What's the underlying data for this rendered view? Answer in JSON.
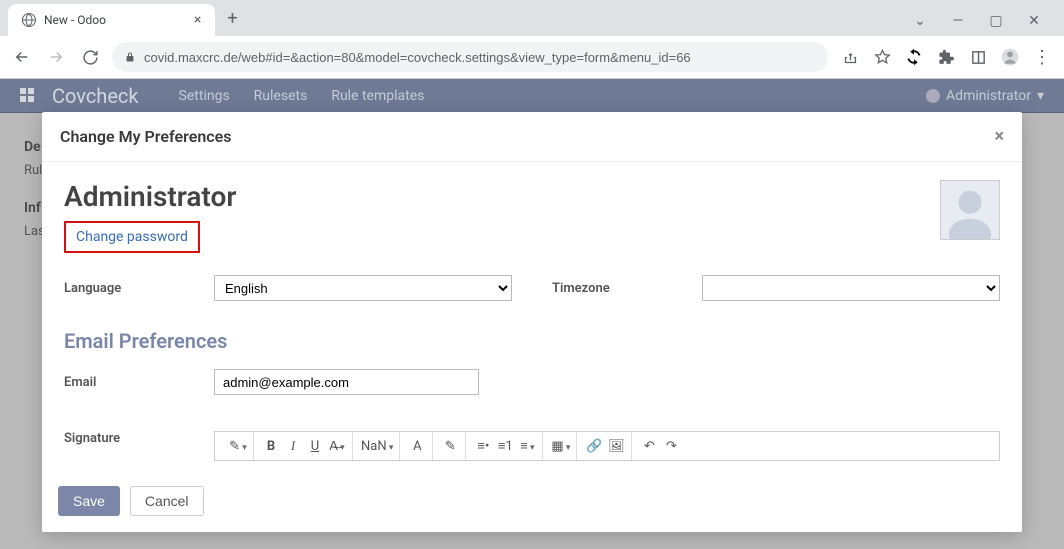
{
  "browser": {
    "tab_title": "New - Odoo",
    "url": "covid.maxcrc.de/web#id=&action=80&model=covcheck.settings&view_type=form&menu_id=66"
  },
  "navbar": {
    "brand": "Covcheck",
    "items": [
      "Settings",
      "Rulesets",
      "Rule templates"
    ],
    "user": "Administrator"
  },
  "page_behind": {
    "h1a": "De",
    "row1": "Rule",
    "h1b": "Inf",
    "row2": "Last"
  },
  "modal": {
    "title": "Change My Preferences",
    "user_name": "Administrator",
    "change_password": "Change password",
    "fields": {
      "language_label": "Language",
      "language_value": "English",
      "timezone_label": "Timezone",
      "timezone_value": ""
    },
    "email_section": {
      "heading": "Email Preferences",
      "email_label": "Email",
      "email_value": "admin@example.com",
      "signature_label": "Signature",
      "font_size": "NaN"
    },
    "buttons": {
      "save": "Save",
      "cancel": "Cancel"
    }
  }
}
